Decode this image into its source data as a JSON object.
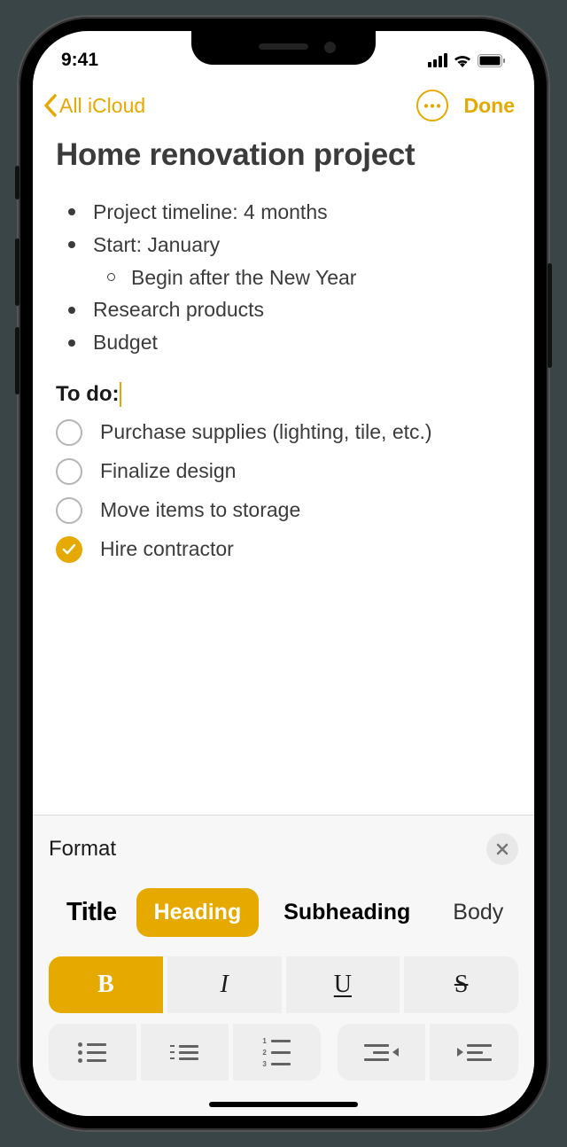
{
  "status": {
    "time": "9:41"
  },
  "nav": {
    "back_label": "All iCloud",
    "done": "Done"
  },
  "note": {
    "title": "Home renovation project",
    "bullets": [
      "Project timeline: 4 months",
      "Start: January",
      "Research products",
      "Budget"
    ],
    "sub_bullet": "Begin after the New Year",
    "heading": "To do:",
    "checklist": [
      {
        "text": "Purchase supplies (lighting, tile, etc.)",
        "checked": false
      },
      {
        "text": "Finalize design",
        "checked": false
      },
      {
        "text": "Move items to storage",
        "checked": false
      },
      {
        "text": "Hire contractor",
        "checked": true
      }
    ]
  },
  "format": {
    "title": "Format",
    "styles": {
      "title": "Title",
      "heading": "Heading",
      "subheading": "Subheading",
      "body": "Body"
    },
    "inline": {
      "bold": "B",
      "italic": "I",
      "underline": "U",
      "strike": "S"
    }
  }
}
